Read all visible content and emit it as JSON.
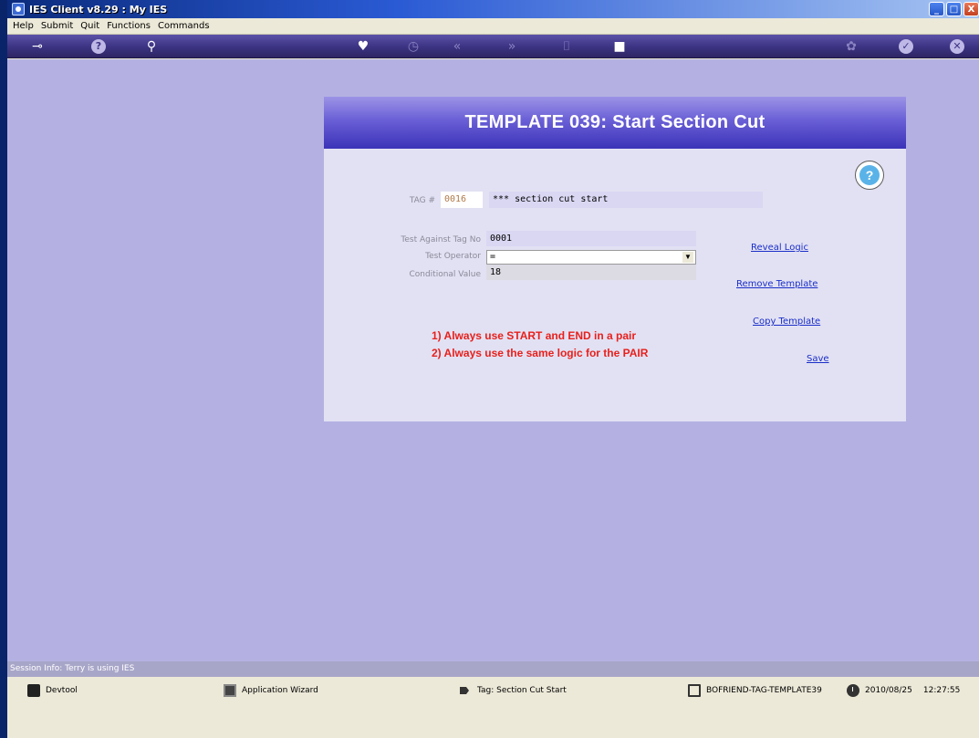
{
  "window": {
    "title": "IES Client v8.29 : My IES",
    "controls": [
      "_",
      "□",
      "X"
    ]
  },
  "menu": [
    "Help",
    "Submit",
    "Quit",
    "Functions",
    "Commands"
  ],
  "toolbar": {
    "icons": [
      "key-icon",
      "help-icon",
      "search-icon",
      "heart-icon",
      "clock-icon",
      "back-icon",
      "forward-icon",
      "bookmark-icon",
      "stop-icon",
      "settings-icon",
      "check-icon",
      "close-icon"
    ],
    "help_glyph": "?",
    "check_glyph": "✓",
    "close_glyph": "✕"
  },
  "panel": {
    "title": "TEMPLATE 039: Start Section Cut",
    "help_glyph": "?",
    "tag_label": "TAG #",
    "tag_value": "0016",
    "tag_description": "*** section cut start",
    "test_against_label": "Test Against Tag No",
    "test_against_value": "0001",
    "test_operator_label": "Test Operator",
    "test_operator_value": "=",
    "conditional_value_label": "Conditional Value",
    "conditional_value": "18",
    "notes": [
      "1) Always use START and END in a pair",
      "2) Always use the same logic for the PAIR"
    ],
    "links": {
      "reveal_logic": "Reveal Logic",
      "remove_template": "Remove Template",
      "copy_template": "Copy Template",
      "save": "Save"
    }
  },
  "session_info": "Session Info: Terry is using IES",
  "status": {
    "devtool": "Devtool",
    "app_wizard": "Application Wizard",
    "tag": "Tag: Section Cut Start",
    "template": "BOFRIEND-TAG-TEMPLATE39",
    "date": "2010/08/25",
    "time": "12:27:55"
  }
}
